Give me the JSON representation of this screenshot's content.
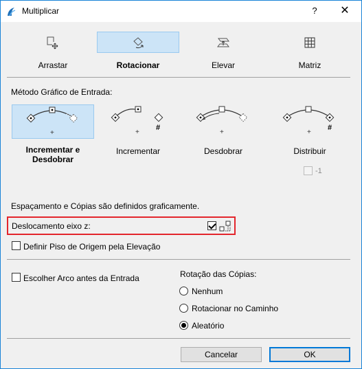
{
  "window": {
    "title": "Multiplicar",
    "help_label": "?",
    "close_label": "✕"
  },
  "modes": [
    {
      "label": "Arrastar",
      "icon": "drag-move-icon",
      "selected": false
    },
    {
      "label": "Rotacionar",
      "icon": "rotate-icon",
      "selected": true
    },
    {
      "label": "Elevar",
      "icon": "elevate-icon",
      "selected": false
    },
    {
      "label": "Matriz",
      "icon": "matrix-grid-icon",
      "selected": false
    }
  ],
  "method": {
    "heading": "Método Gráfico de Entrada:",
    "options": [
      {
        "label_line1": "Incrementar e",
        "label_line2": "Desdobrar",
        "selected": true
      },
      {
        "label_line1": "Incrementar",
        "label_line2": "",
        "selected": false
      },
      {
        "label_line1": "Desdobrar",
        "label_line2": "",
        "selected": false
      },
      {
        "label_line1": "Distribuir",
        "label_line2": "",
        "selected": false
      }
    ],
    "distribute_count_label": "-1",
    "hash_symbol": "#",
    "plus_symbol": "+"
  },
  "info_text": "Espaçamento e Cópias são definidos graficamente.",
  "z_offset": {
    "label": "Deslocamento eixo z:",
    "checked": true
  },
  "floor_option": {
    "label": "Definir Piso de Origem pela Elevação",
    "checked": false
  },
  "arc_option": {
    "label": "Escolher Arco antes da Entrada",
    "checked": false
  },
  "rotation": {
    "heading": "Rotação das Cópias:",
    "options": [
      {
        "label": "Nenhum",
        "checked": false
      },
      {
        "label": "Rotacionar no Caminho",
        "checked": false
      },
      {
        "label": "Aleatório",
        "checked": true
      }
    ]
  },
  "buttons": {
    "cancel": "Cancelar",
    "ok": "OK"
  },
  "colors": {
    "selection": "#cce4f7",
    "highlight_border": "#e3252c",
    "default_button_border": "#0078d7"
  }
}
